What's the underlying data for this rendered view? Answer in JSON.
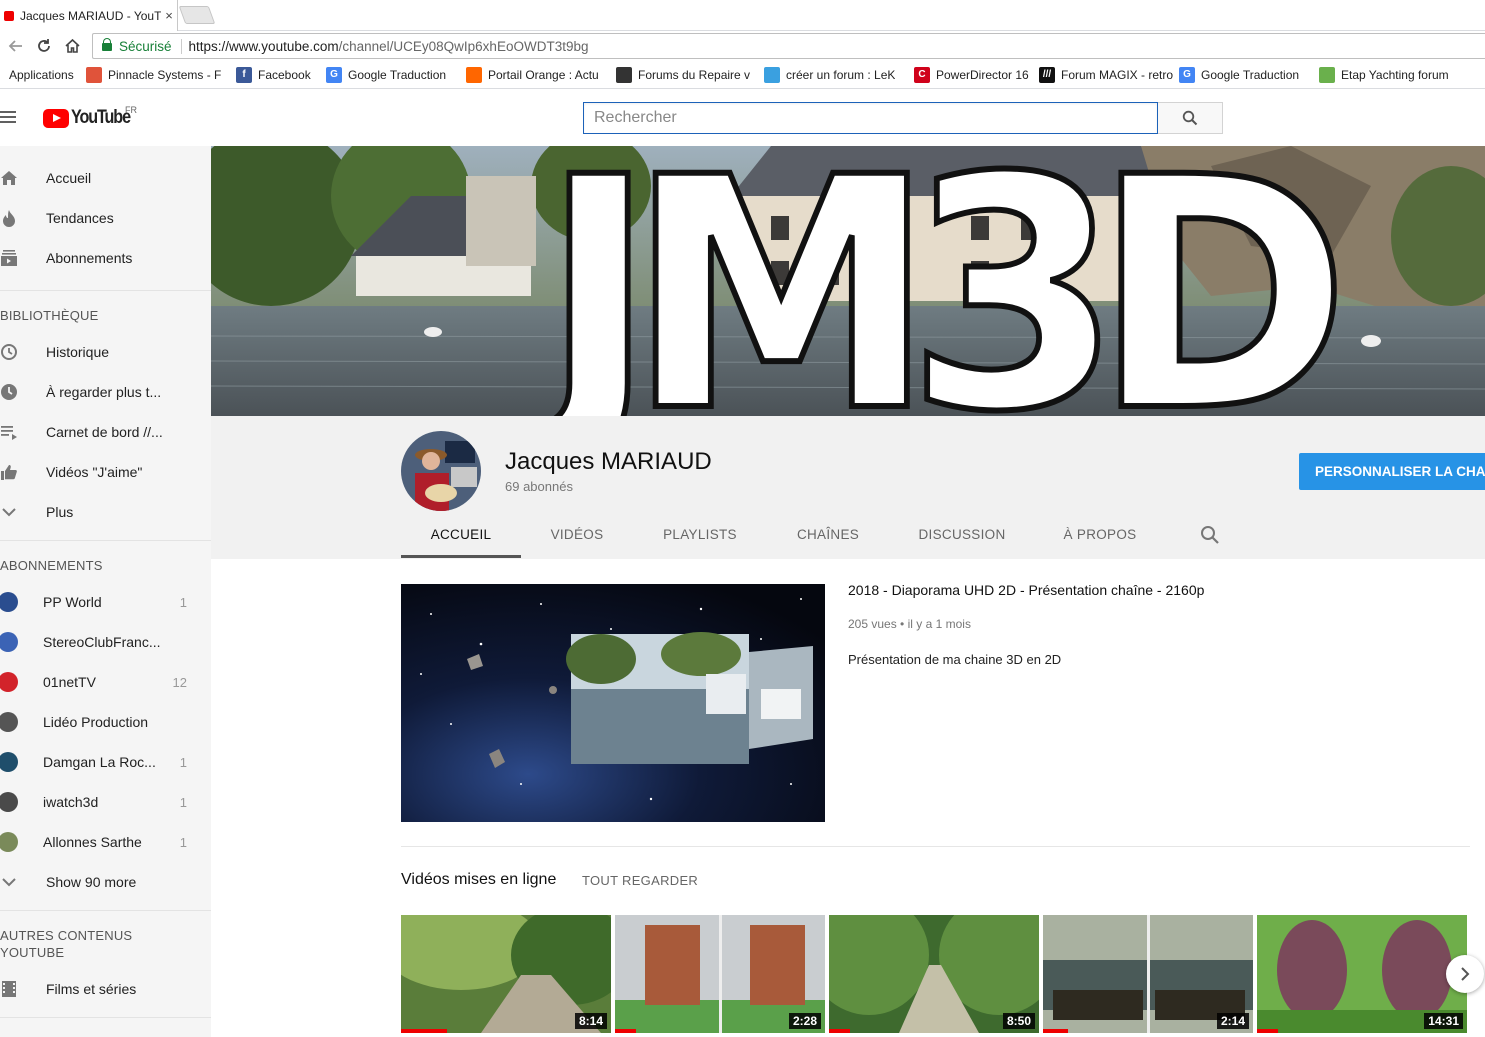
{
  "browser": {
    "tab_title": "Jacques MARIAUD - YouT",
    "close": "×",
    "secure_label": "Sécurisé",
    "url_host": "https://www.youtube.com",
    "url_path": "/channel/UCEy08QwIp6xhEoOWDT3t9bg"
  },
  "bookmarks": [
    {
      "label": "Applications",
      "icon": "apps-icon",
      "color": "#4285f4",
      "text": ""
    },
    {
      "label": "Pinnacle Systems - F",
      "icon": "pinnacle-icon",
      "color": "#e0533a",
      "text": ""
    },
    {
      "label": "Facebook",
      "icon": "facebook-icon",
      "color": "#3b5998",
      "text": "f"
    },
    {
      "label": "Google Traduction",
      "icon": "translate-icon",
      "color": "#4285f4",
      "text": "G"
    },
    {
      "label": "Portail Orange : Actu",
      "icon": "orange-icon",
      "color": "#ff6600",
      "text": ""
    },
    {
      "label": "Forums du Repaire v",
      "icon": "eye-icon",
      "color": "#333333",
      "text": ""
    },
    {
      "label": "créer un forum : LeK",
      "icon": "chat-icon",
      "color": "#3aa0e0",
      "text": ""
    },
    {
      "label": "PowerDirector 16",
      "icon": "cyberlink-icon",
      "color": "#d0021b",
      "text": "C"
    },
    {
      "label": "Forum MAGIX - retro",
      "icon": "magix-icon",
      "color": "#111111",
      "text": "///"
    },
    {
      "label": "Google Traduction",
      "icon": "translate-icon",
      "color": "#4285f4",
      "text": "G"
    },
    {
      "label": "Etap Yachting forum",
      "icon": "forum-icon",
      "color": "#6ab04c",
      "text": ""
    }
  ],
  "masthead": {
    "logo_text": "YouTube",
    "country": "FR",
    "search_placeholder": "Rechercher"
  },
  "sidebar": {
    "main": [
      {
        "label": "Accueil",
        "icon": "home-icon"
      },
      {
        "label": "Tendances",
        "icon": "trending-icon"
      },
      {
        "label": "Abonnements",
        "icon": "subscriptions-icon"
      }
    ],
    "library_header": "BIBLIOTHÈQUE",
    "library": [
      {
        "label": "Historique",
        "icon": "history-icon"
      },
      {
        "label": "À regarder plus t...",
        "icon": "watch-later-icon"
      },
      {
        "label": "Carnet de bord //...",
        "icon": "playlist-icon"
      },
      {
        "label": "Vidéos \"J'aime\"",
        "icon": "thumbs-up-icon"
      },
      {
        "label": "Plus",
        "icon": "chevron-down-icon"
      }
    ],
    "subs_header": "ABONNEMENTS",
    "subscriptions": [
      {
        "label": "PP World",
        "count": "1",
        "color": "#2a4d8f"
      },
      {
        "label": "StereoClubFranc...",
        "count": "",
        "color": "#3b63b5"
      },
      {
        "label": "01netTV",
        "count": "12",
        "color": "#d2232a"
      },
      {
        "label": "Lidéo Production",
        "count": "",
        "color": "#555555"
      },
      {
        "label": "Damgan La Roc...",
        "count": "1",
        "color": "#1f4e6b"
      },
      {
        "label": "iwatch3d",
        "count": "1",
        "color": "#4a4a4a"
      },
      {
        "label": "Allonnes Sarthe",
        "count": "1",
        "color": "#7a8a5a"
      }
    ],
    "show_more": "Show 90 more",
    "others_header": "AUTRES CONTENUS YOUTUBE",
    "others": [
      {
        "label": "Films et séries",
        "icon": "film-icon"
      }
    ]
  },
  "channel": {
    "banner_text": "JM3D",
    "name": "Jacques MARIAUD",
    "subscribers": "69 abonnés",
    "customize_button": "PERSONNALISER LA CHAÎNE",
    "tabs": [
      {
        "label": "ACCUEIL",
        "active": true
      },
      {
        "label": "VIDÉOS",
        "active": false
      },
      {
        "label": "PLAYLISTS",
        "active": false
      },
      {
        "label": "CHAÎNES",
        "active": false
      },
      {
        "label": "DISCUSSION",
        "active": false
      },
      {
        "label": "À PROPOS",
        "active": false
      }
    ]
  },
  "featured": {
    "title": "2018 - Diaporama UHD 2D - Présentation chaîne - 2160p",
    "views": "205 vues",
    "dot": "•",
    "age": "il y a 1 mois",
    "description": "Présentation de ma chaine 3D en 2D"
  },
  "shelf": {
    "title": "Vidéos mises en ligne",
    "see_all": "TOUT REGARDER",
    "videos": [
      {
        "duration": "8:14",
        "progress": 0.22
      },
      {
        "duration": "2:28",
        "progress": 0.1
      },
      {
        "duration": "8:50",
        "progress": 0.1
      },
      {
        "duration": "2:14",
        "progress": 0.12
      },
      {
        "duration": "14:31",
        "progress": 0.1
      }
    ]
  },
  "colors": {
    "brand_red": "#ff0000",
    "accent_blue": "#2793e6"
  }
}
